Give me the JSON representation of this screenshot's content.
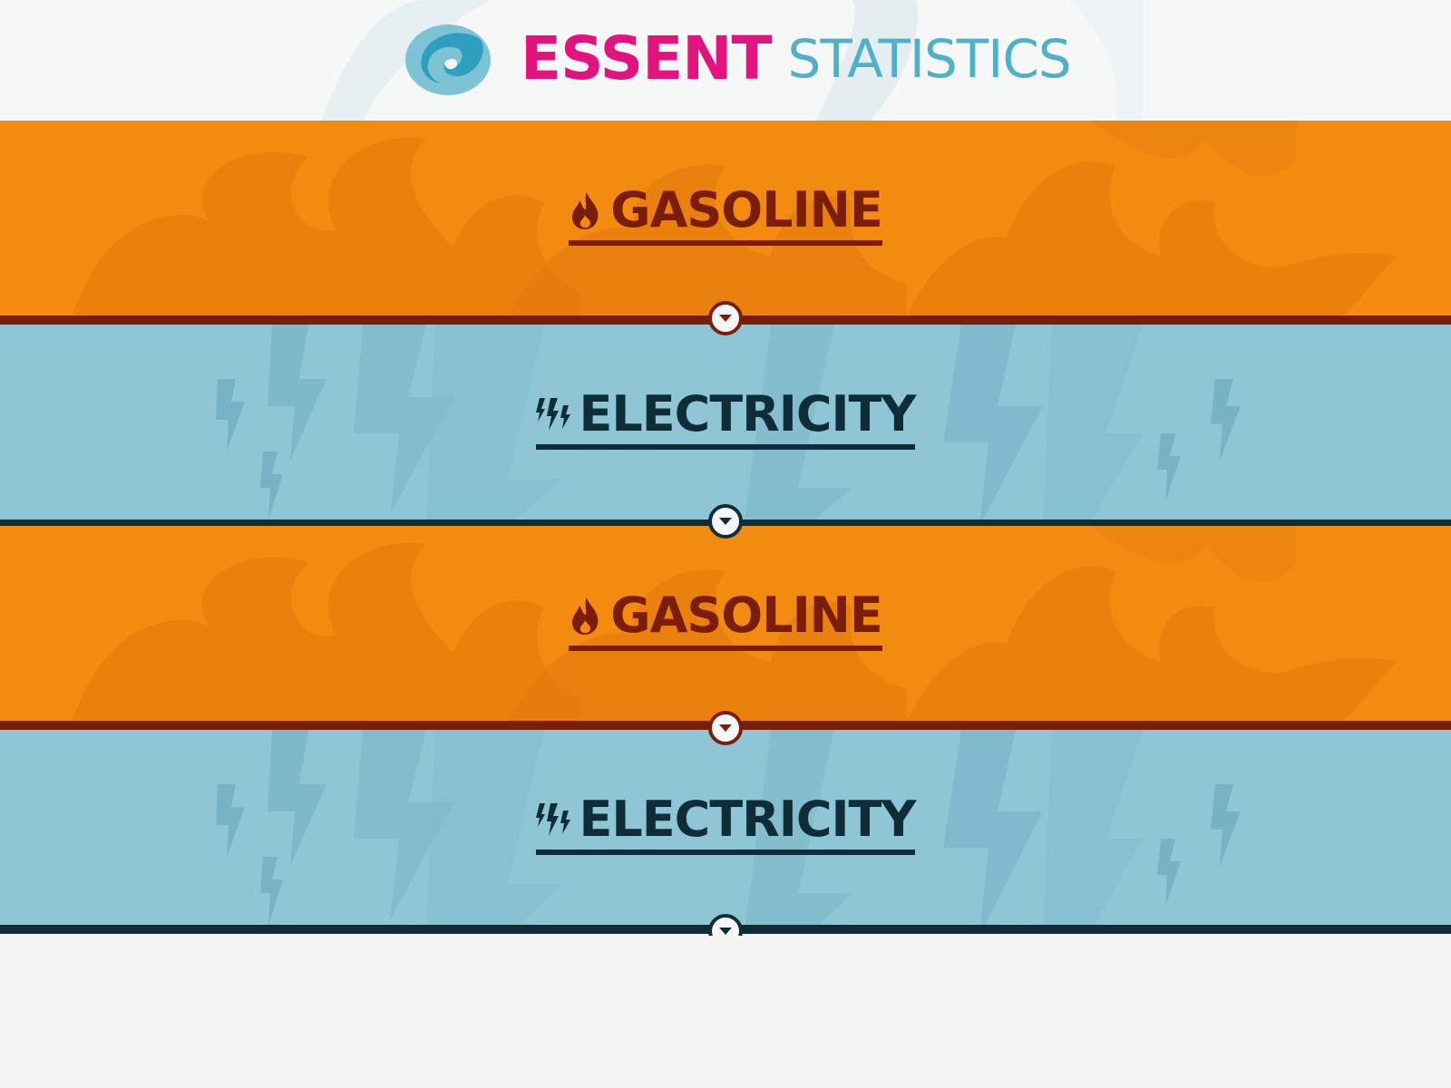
{
  "header": {
    "brand": "ESSENT",
    "subtitle": "STATISTICS",
    "logo_icon": "essent-swirl-logo",
    "brand_color": "#e2137e",
    "subtitle_color": "#4fb1c9"
  },
  "sections": [
    {
      "label": "GASOLINE",
      "icon": "flame-icon",
      "theme": "gas"
    },
    {
      "label": "ELECTRICITY",
      "icon": "lightning-icon",
      "theme": "electricity"
    },
    {
      "label": "GASOLINE",
      "icon": "flame-icon",
      "theme": "gas"
    },
    {
      "label": "ELECTRICITY",
      "icon": "lightning-icon",
      "theme": "electricity"
    }
  ],
  "colors": {
    "gas_bg": "#f28b10",
    "gas_dark": "#7a1e0a",
    "electricity_bg": "#8ec6d6",
    "electricity_dark": "#0f2d36"
  }
}
